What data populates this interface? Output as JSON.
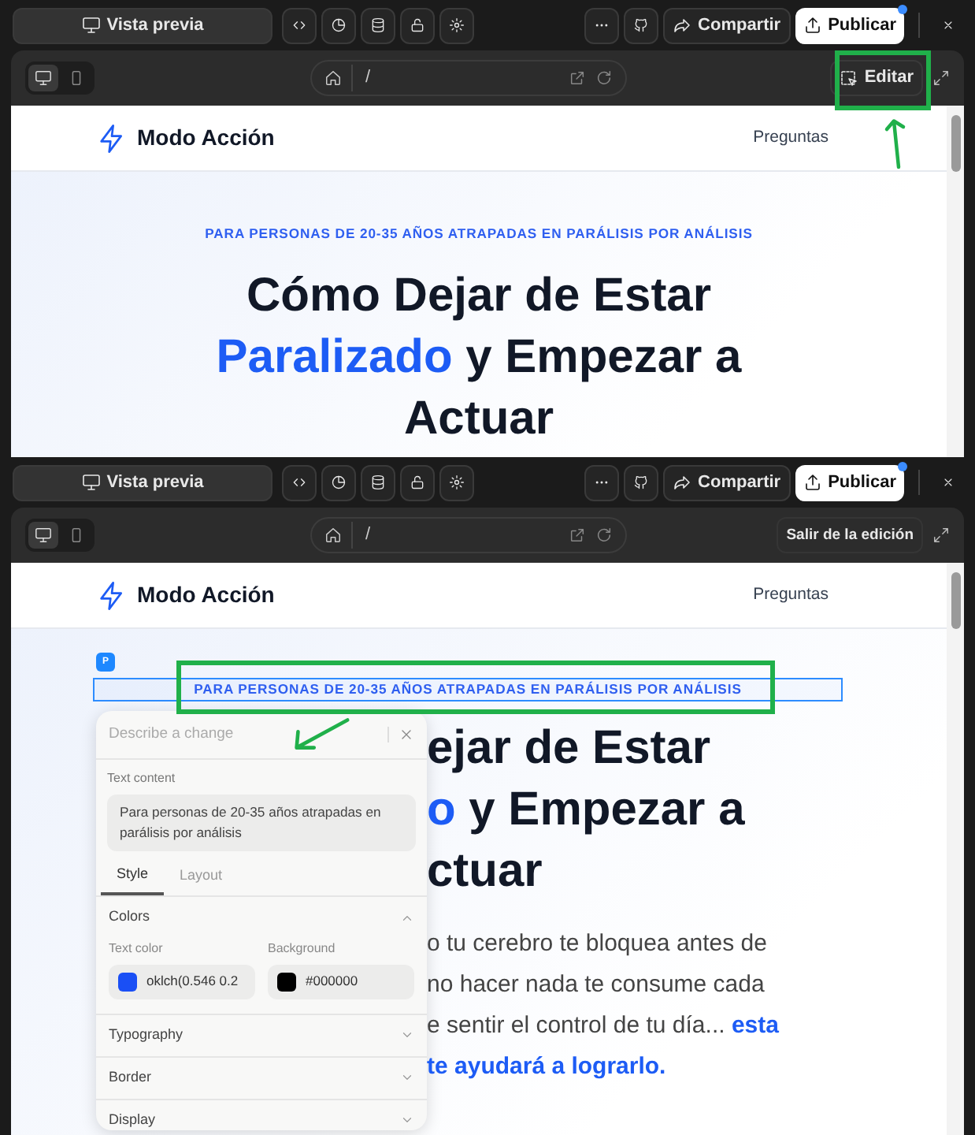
{
  "screens": [
    {
      "toolbar": {
        "preview_button": "Vista previa",
        "share_button": "Compartir",
        "publish_button": "Publicar",
        "publish_notification": true
      },
      "preview_bar": {
        "devices": [
          {
            "kind": "desktop",
            "selected": true
          },
          {
            "kind": "mobile",
            "selected": false
          }
        ],
        "url": "/",
        "edit_button": {
          "label": "Editar",
          "kind": "button",
          "annotated": true
        }
      },
      "site": {
        "brand": "Modo Acción",
        "nav_link": "Preguntas",
        "hero": {
          "tagline": {
            "text": "PARA PERSONAS DE 20-35 AÑOS ATRAPADAS EN PARÁLISIS POR ANÁLISIS",
            "selected": false,
            "annotated": false
          },
          "heading_lines": [
            [
              {
                "text": "Cómo Dejar de Estar",
                "highlight": false
              }
            ],
            [
              {
                "text": "Paralizado",
                "highlight": true
              },
              {
                "text": " y Empezar a",
                "highlight": false
              }
            ],
            [
              {
                "text": "Actuar",
                "highlight": false
              }
            ]
          ]
        }
      }
    },
    {
      "toolbar": {
        "preview_button": "Vista previa",
        "share_button": "Compartir",
        "publish_button": "Publicar",
        "publish_notification": true
      },
      "preview_bar": {
        "devices": [
          {
            "kind": "desktop",
            "selected": true
          },
          {
            "kind": "mobile",
            "selected": false
          }
        ],
        "url": "/",
        "edit_button": {
          "label": "Salir de la edición",
          "kind": "text",
          "annotated": false
        }
      },
      "site": {
        "brand": "Modo Acción",
        "nav_link": "Preguntas",
        "hero": {
          "selection_badge": "P",
          "tagline": {
            "text": "PARA PERSONAS DE 20-35 AÑOS ATRAPADAS EN PARÁLISIS POR ANÁLISIS",
            "selected": true,
            "annotated": true
          },
          "heading_lines": [
            [
              {
                "text": "ejar de Estar",
                "highlight": false
              }
            ],
            [
              {
                "text": "o",
                "highlight": true
              },
              {
                "text": " y Empezar a",
                "highlight": false
              }
            ],
            [
              {
                "text": "ctuar",
                "highlight": false
              }
            ]
          ],
          "paragraph_lines": [
            [
              {
                "text": "o tu cerebro te bloquea antes de",
                "highlight": false
              }
            ],
            [
              {
                "text": "no hacer nada te consume cada",
                "highlight": false
              }
            ],
            [
              {
                "text": "e sentir el control de tu día... ",
                "highlight": false
              },
              {
                "text": "esta",
                "highlight": true
              }
            ],
            [
              {
                "text": "te ayudará a lograrlo.",
                "highlight": true
              }
            ]
          ]
        },
        "editor": {
          "placeholder": "Describe a change",
          "text_content_label": "Text content",
          "text_content": "Para personas de 20-35 años atrapadas en parálisis por análisis",
          "tabs": [
            {
              "label": "Style",
              "selected": true
            },
            {
              "label": "Layout",
              "selected": false
            }
          ],
          "sections": [
            {
              "title": "Colors",
              "expanded": true,
              "fields": [
                {
                  "label": "Text color",
                  "color": "#1a4ff5",
                  "value": "oklch(0.546 0.2"
                },
                {
                  "label": "Background",
                  "color": "#000000",
                  "value": "#000000"
                }
              ]
            },
            {
              "title": "Typography",
              "expanded": false
            },
            {
              "title": "Border",
              "expanded": false
            },
            {
              "title": "Display",
              "expanded": false
            }
          ]
        }
      }
    }
  ]
}
